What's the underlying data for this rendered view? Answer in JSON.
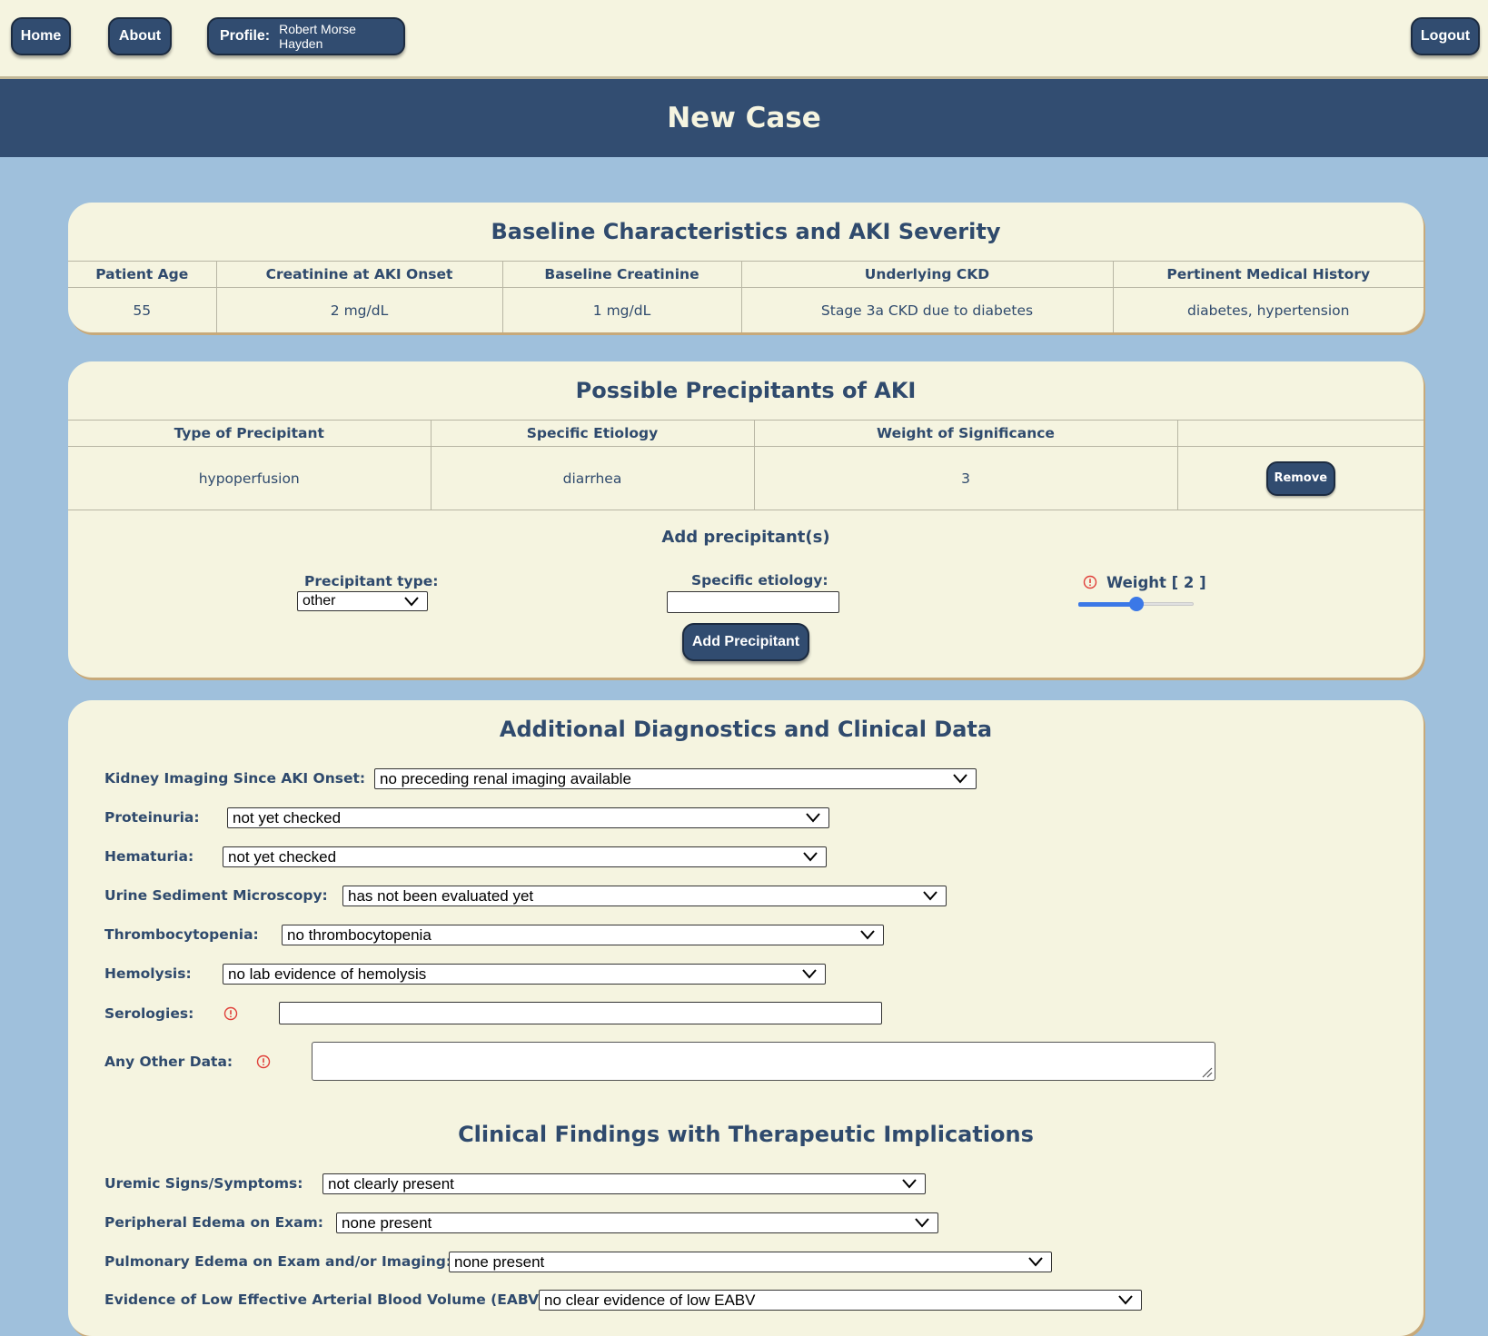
{
  "nav": {
    "home": "Home",
    "about": "About",
    "profile_label": "Profile:",
    "profile_name": "Robert Morse Hayden",
    "logout": "Logout"
  },
  "page_title": "New Case",
  "baseline": {
    "title": "Baseline Characteristics and AKI Severity",
    "headers": [
      "Patient Age",
      "Creatinine at AKI Onset",
      "Baseline Creatinine",
      "Underlying CKD",
      "Pertinent Medical History"
    ],
    "values": [
      "55",
      "2 mg/dL",
      "1 mg/dL",
      "Stage 3a CKD due to diabetes",
      "diabetes, hypertension"
    ]
  },
  "precipitants": {
    "title": "Possible Precipitants of AKI",
    "headers": [
      "Type of Precipitant",
      "Specific Etiology",
      "Weight of Significance",
      ""
    ],
    "rows": [
      {
        "type": "hypoperfusion",
        "etiology": "diarrhea",
        "weight": "3",
        "remove_label": "Remove"
      }
    ],
    "add_heading": "Add precipitant(s)",
    "type_label": "Precipitant type:",
    "type_value": "other",
    "etiology_label": "Specific etiology:",
    "etiology_value": "",
    "weight_label": "Weight [ 2 ]",
    "weight_value": 2,
    "weight_min": 0,
    "weight_max": 4,
    "add_button": "Add Precipitant"
  },
  "diagnostics": {
    "title": "Additional Diagnostics and Clinical Data",
    "kidney_imaging": {
      "label": "Kidney Imaging Since AKI Onset:",
      "value": "no preceding renal imaging available"
    },
    "proteinuria": {
      "label": "Proteinuria:",
      "value": "not yet checked"
    },
    "hematuria": {
      "label": "Hematuria:",
      "value": "not yet checked"
    },
    "urine_sediment": {
      "label": "Urine Sediment Microscopy:",
      "value": "has not been evaluated yet"
    },
    "thrombocytopenia": {
      "label": "Thrombocytopenia:",
      "value": "no thrombocytopenia"
    },
    "hemolysis": {
      "label": "Hemolysis:",
      "value": "no lab evidence of hemolysis"
    },
    "serologies": {
      "label": "Serologies:",
      "value": ""
    },
    "other_data": {
      "label": "Any Other Data:",
      "value": ""
    }
  },
  "clinical": {
    "title": "Clinical Findings with Therapeutic Implications",
    "uremic": {
      "label": "Uremic Signs/Symptoms:",
      "value": "not clearly present"
    },
    "peripheral_edema": {
      "label": "Peripheral Edema on Exam:",
      "value": "none present"
    },
    "pulmonary_edema": {
      "label": "Pulmonary Edema on Exam and/or Imaging:",
      "value": "none present"
    },
    "eabv": {
      "label": "Evidence of Low Effective Arterial Blood Volume (EABV):",
      "value": "no clear evidence of low EABV"
    }
  },
  "colors": {
    "page_bg": "#9fc0dc",
    "panel_bg": "#f5f4e0",
    "navy": "#324d71",
    "slider": "#3b78e7",
    "warning": "#e0403a"
  }
}
